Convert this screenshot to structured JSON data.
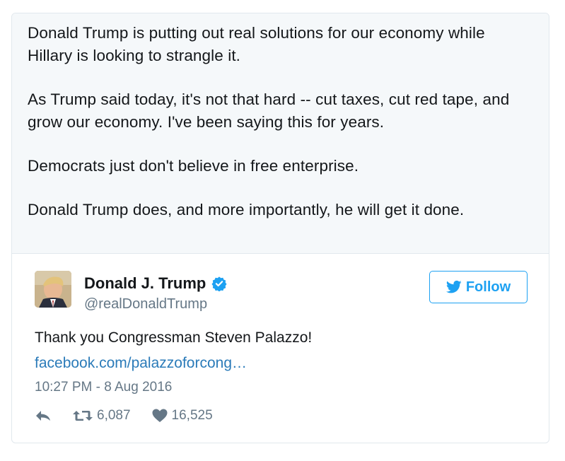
{
  "quoted_text": {
    "paragraphs": [
      "Donald Trump is putting out real solutions for our economy while Hillary is looking to strangle it.",
      "As Trump said today, it's not that hard -- cut taxes, cut red tape, and grow our economy. I've been saying this for years.",
      "Democrats just don't believe in free enterprise.",
      "Donald Trump does, and more importantly, he will get it done."
    ]
  },
  "tweet": {
    "display_name": "Donald J. Trump",
    "handle": "@realDonaldTrump",
    "follow_label": "Follow",
    "text": "Thank you Congressman Steven Palazzo!",
    "link": "facebook.com/palazzoforcong…",
    "timestamp": "10:27 PM - 8 Aug 2016",
    "retweets": "6,087",
    "likes": "16,525"
  },
  "icons": {
    "verified": "verified-badge-icon",
    "follow": "twitter-bird-icon",
    "reply": "reply-icon",
    "retweet": "retweet-icon",
    "like": "heart-icon"
  },
  "colors": {
    "brand_blue": "#1da1f2",
    "link_blue": "#2b7bb9",
    "muted_gray": "#657786",
    "quote_background": "#f5f8fa"
  }
}
